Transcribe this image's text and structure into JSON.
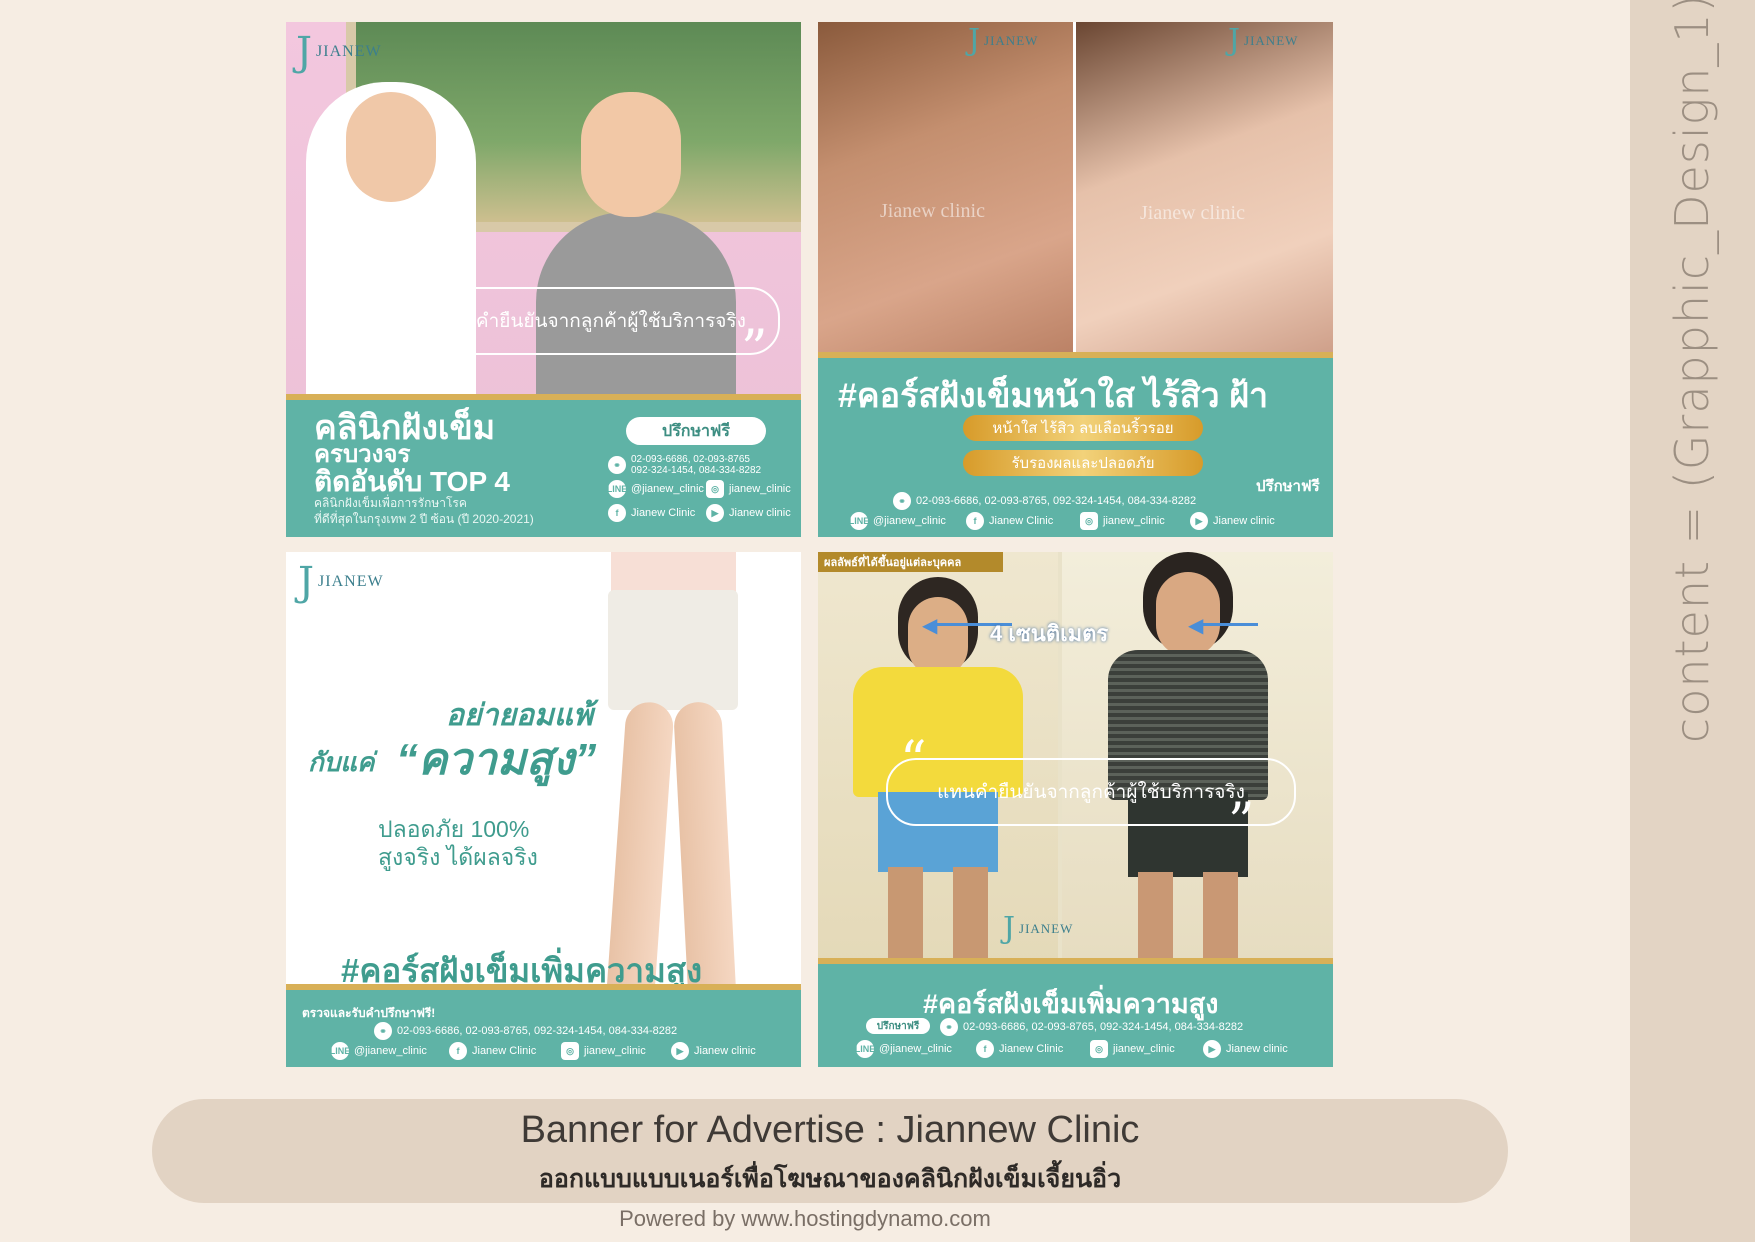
{
  "sidebar": {
    "text": "content = (Grapphic_Design_1);"
  },
  "logo": {
    "mark": "J",
    "name": "JIANEW"
  },
  "banner1": {
    "quote": "แทนคำยืนยันจากลูกค้าผู้ใช้บริการจริง",
    "title1": "คลินิกฝังเข็ม",
    "title2": "ครบวงจร",
    "title3": "ติดอันดับ TOP 4",
    "desc1": "คลินิกฝังเข็มเพื่อการรักษาโรค",
    "desc2": "ที่ดีที่สุดในกรุงเทพ 2 ปี ซ้อน (ปี 2020-2021)",
    "consult": "ปรึกษาฟรี",
    "phone1": "02-093-6686, 02-093-8765",
    "phone2": "092-324-1454, 084-334-8282",
    "line": "@jianew_clinic",
    "ig": "jianew_clinic",
    "fb": "Jianew Clinic",
    "yt": "Jianew clinic"
  },
  "banner2": {
    "watermark": "Jianew clinic",
    "title": "#คอร์สฝังเข็มหน้าใส ไร้สิว ฝ้า",
    "pill1": "หน้าใส ไร้สิว ลบเลือนริ้วรอย",
    "pill2": "รับรองผลและปลอดภัย",
    "consult": "ปรึกษาฟรี",
    "phones": "02-093-6686, 02-093-8765, 092-324-1454, 084-334-8282",
    "line": "@jianew_clinic",
    "fb": "Jianew Clinic",
    "ig": "jianew_clinic",
    "yt": "Jianew clinic"
  },
  "banner3": {
    "h1": "อย่ายอมแพ้",
    "h2a": "กับแค่",
    "h2b": "“ความสูง”",
    "s1": "ปลอดภัย 100%",
    "s2": "สูงจริง ได้ผลจริง",
    "title": "#คอร์สฝังเข็มเพิ่มความสูง",
    "check": "ตรวจและรับคำปรึกษาฟรี!",
    "phones": "02-093-6686, 02-093-8765, 092-324-1454, 084-334-8282",
    "line": "@jianew_clinic",
    "fb": "Jianew Clinic",
    "ig": "jianew_clinic",
    "yt": "Jianew clinic"
  },
  "banner4": {
    "tag": "ผลลัพธ์ที่ได้ขึ้นอยู่แต่ละบุคคล",
    "measure": "4 เซนติเมตร",
    "quote": "แทนคำยืนยันจากลูกค้าผู้ใช้บริการจริง",
    "title": "#คอร์สฝังเข็มเพิ่มความสูง",
    "consult": "ปรึกษาฟรี",
    "phones": "02-093-6686, 02-093-8765, 092-324-1454, 084-334-8282",
    "line": "@jianew_clinic",
    "fb": "Jianew Clinic",
    "ig": "jianew_clinic",
    "yt": "Jianew clinic"
  },
  "caption": {
    "title": "Banner for Advertise : Jiannew Clinic",
    "subtitle": "ออกแบบแบบเนอร์เพื่อโฆษณาของคลินิกฝังเข็มเจี้ยนอิ่ว"
  },
  "powered": "Powered by www.hostingdynamo.com",
  "colors": {
    "teal": "#5fb3a6",
    "gold": "#d8b057",
    "background": "#f6ede3",
    "rail": "#e3d4c4"
  },
  "icons": [
    "link-icon",
    "line-icon",
    "instagram-icon",
    "facebook-icon",
    "youtube-icon",
    "arrow-left-icon"
  ]
}
